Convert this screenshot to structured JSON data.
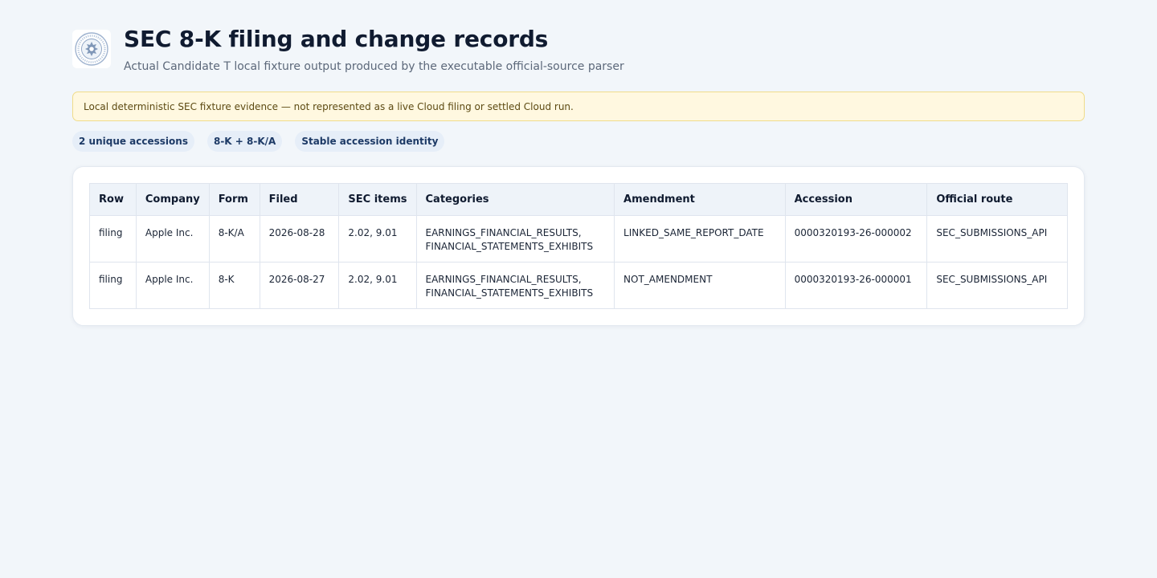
{
  "header": {
    "title": "SEC 8-K filing and change records",
    "subtitle": "Actual Candidate T local fixture output produced by the executable official-source parser",
    "logo_icon": "sec-seal-icon"
  },
  "notice": {
    "text": "Local deterministic SEC fixture evidence — not represented as a live Cloud filing or settled Cloud run."
  },
  "pills": [
    {
      "label": "2 unique accessions"
    },
    {
      "label": "8-K + 8-K/A"
    },
    {
      "label": "Stable accession identity"
    }
  ],
  "table": {
    "columns": [
      "Row",
      "Company",
      "Form",
      "Filed",
      "SEC items",
      "Categories",
      "Amendment",
      "Accession",
      "Official route"
    ],
    "rows": [
      {
        "row": "filing",
        "company": "Apple Inc.",
        "form": "8-K/A",
        "filed": "2026-08-28",
        "sec_items": "2.02, 9.01",
        "categories_line1": "EARNINGS_FINANCIAL_RESULTS,",
        "categories_line2": "FINANCIAL_STATEMENTS_EXHIBITS",
        "amendment": "LINKED_SAME_REPORT_DATE",
        "accession": "0000320193-26-000002",
        "official_route": "SEC_SUBMISSIONS_API"
      },
      {
        "row": "filing",
        "company": "Apple Inc.",
        "form": "8-K",
        "filed": "2026-08-27",
        "sec_items": "2.02, 9.01",
        "categories_line1": "EARNINGS_FINANCIAL_RESULTS,",
        "categories_line2": "FINANCIAL_STATEMENTS_EXHIBITS",
        "amendment": "NOT_AMENDMENT",
        "accession": "0000320193-26-000001",
        "official_route": "SEC_SUBMISSIONS_API"
      }
    ]
  },
  "colors": {
    "background": "#f2f6fa",
    "notice_bg": "#fff8e0",
    "notice_border": "#f0dc8a",
    "pill_bg": "#e6eef8",
    "header_bg": "#eef3f9"
  }
}
